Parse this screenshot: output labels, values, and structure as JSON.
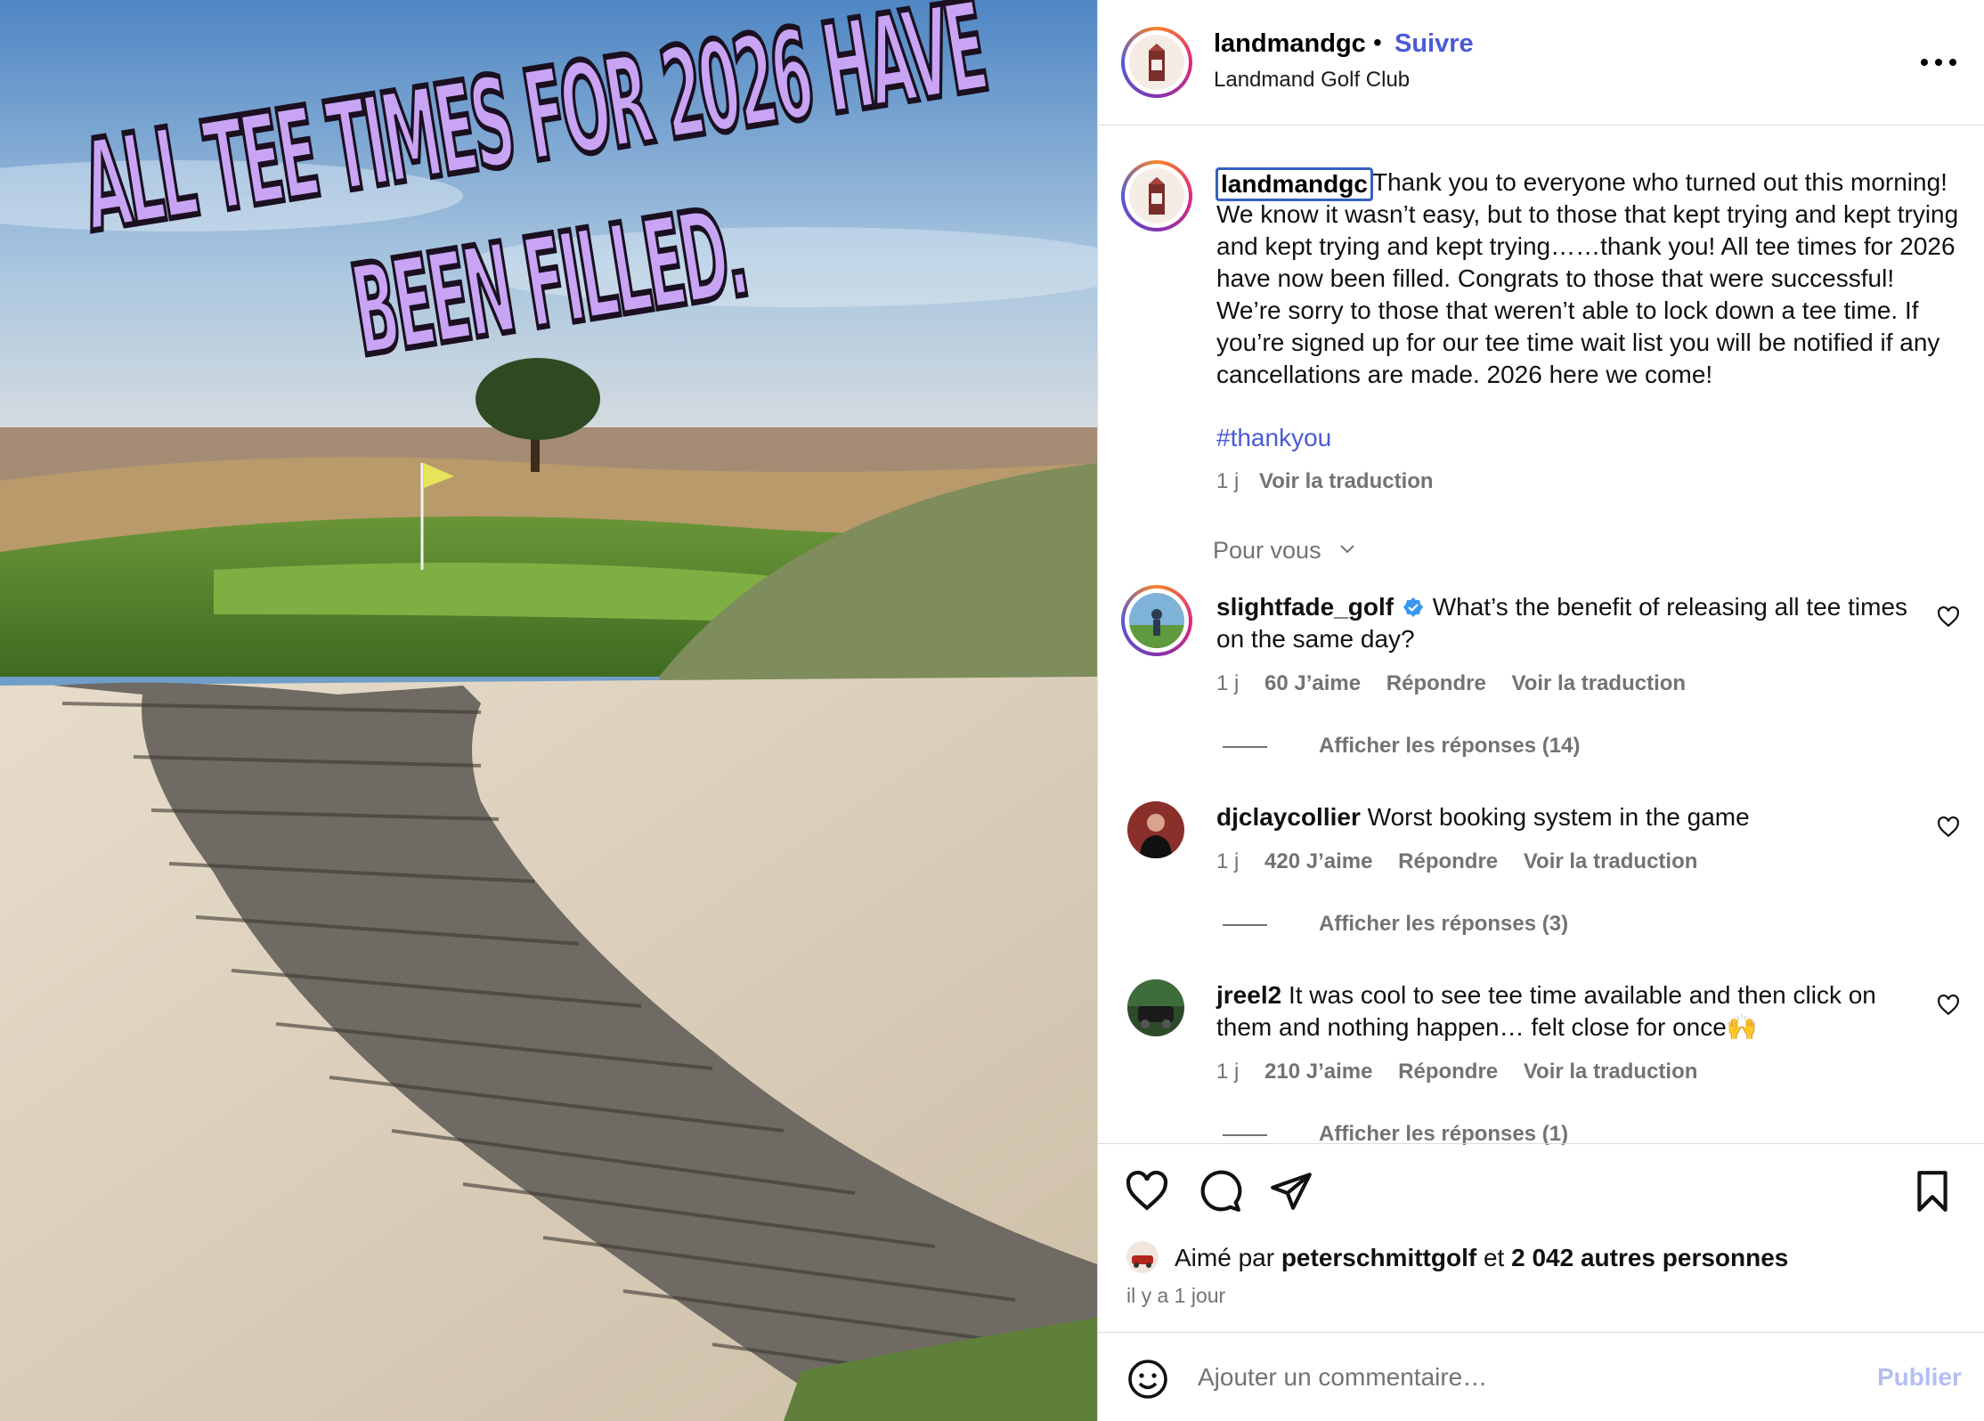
{
  "photo": {
    "headline_line1": "ALL TEE TIMES FOR 2026 HAVE",
    "headline_line2": "BEEN FILLED."
  },
  "header": {
    "username": "landmandgc",
    "separator": "•",
    "follow_label": "Suivre",
    "subtitle": "Landmand Golf Club"
  },
  "caption": {
    "username": "landmandgc",
    "text": "Thank you to everyone who turned out this morning!\nWe know it wasn’t easy, but to those that kept trying and kept trying and kept trying and kept trying……thank you! All tee times for 2026 have now been filled. Congrats to those that were successful! We’re sorry to those that weren’t able to lock down a tee time. If you’re signed up for our tee time wait list you will be notified if any cancellations are made. 2026 here we come!",
    "hashtag": "#thankyou",
    "time": "1 j",
    "translate_label": "Voir la traduction"
  },
  "section_label": "Pour vous",
  "comments": [
    {
      "username": "slightfade_golf",
      "verified": true,
      "text": "What’s the benefit of releasing all tee times on the same day?",
      "time": "1 j",
      "likes": "60 J’aime",
      "reply_label": "Répondre",
      "translate_label": "Voir la traduction",
      "replies_label": "Afficher les réponses (14)"
    },
    {
      "username": "djclaycollier",
      "verified": false,
      "text": "Worst booking system in the game",
      "time": "1 j",
      "likes": "420 J’aime",
      "reply_label": "Répondre",
      "translate_label": "Voir la traduction",
      "replies_label": "Afficher les réponses (3)"
    },
    {
      "username": "jreel2",
      "verified": false,
      "text": "It was cool to see tee time available and then click on them and nothing happen… felt close for once🙌",
      "time": "1 j",
      "likes": "210 J’aime",
      "reply_label": "Répondre",
      "translate_label": "Voir la traduction",
      "replies_label": "Afficher les réponses (1)"
    }
  ],
  "likes": {
    "prefix": "Aimé par",
    "user": "peterschmittgolf",
    "joiner": "et",
    "others": "2 042 autres personnes"
  },
  "post_time": "il y a 1 jour",
  "add_comment": {
    "placeholder": "Ajouter un commentaire…",
    "publish_label": "Publier"
  },
  "colors": {
    "link_blue": "#4a5ad6",
    "headline_lilac": "#c9a4f4",
    "muted_gray": "#737373"
  },
  "icons": [
    "heart-icon",
    "comment-icon",
    "share-icon",
    "bookmark-icon",
    "emoji-icon",
    "more-icon",
    "verified-icon",
    "chevron-down-icon"
  ]
}
